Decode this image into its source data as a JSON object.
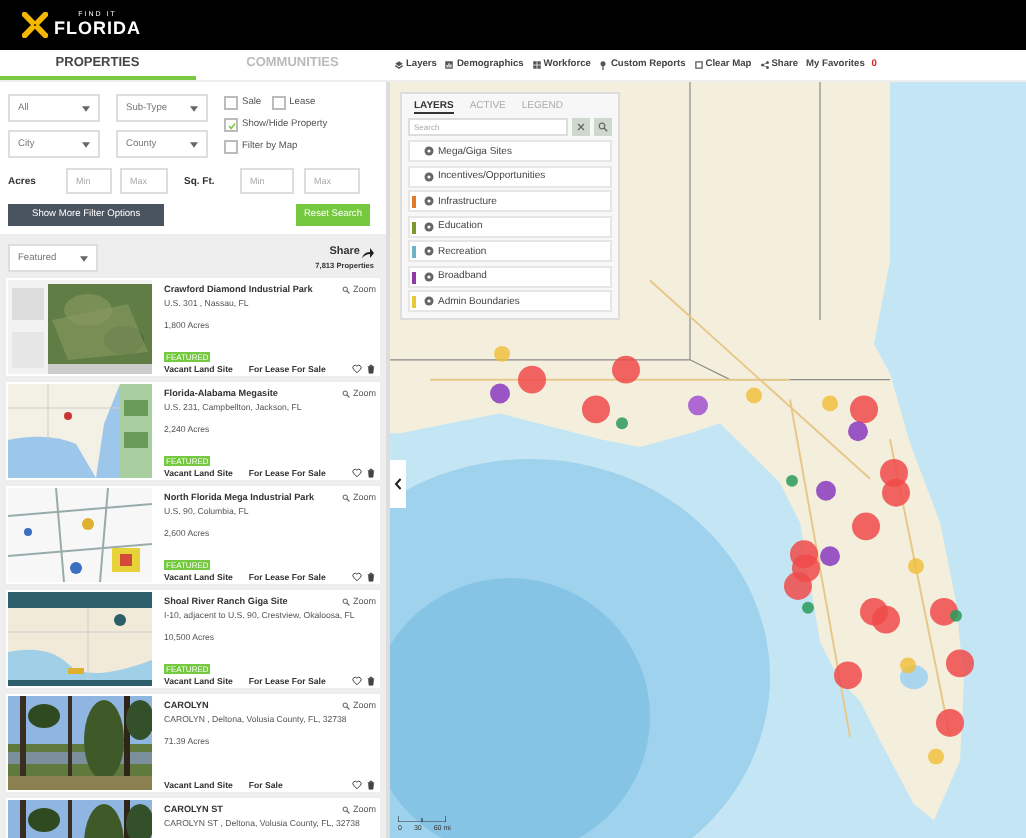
{
  "header": {
    "logo_small": "FIND IT",
    "logo": "FLORIDA"
  },
  "tabs": [
    {
      "label": "PROPERTIES",
      "selected": true
    },
    {
      "label": "COMMUNITIES",
      "selected": false
    }
  ],
  "toolbar": [
    {
      "label": "Layers"
    },
    {
      "label": "Demographics"
    },
    {
      "label": "Workforce"
    },
    {
      "label": "Custom Reports"
    },
    {
      "label": "Clear Map"
    },
    {
      "label": "Share"
    }
  ],
  "favorites": {
    "label": "My Favorites",
    "count": "0"
  },
  "filters": {
    "selects": [
      "All",
      "Sub-Type",
      "City",
      "County"
    ],
    "checkboxes": [
      {
        "label": "Sale",
        "checked": false
      },
      {
        "label": "Lease",
        "checked": false
      },
      {
        "label": "Show/Hide Property",
        "checked": true
      },
      {
        "label": "Filter by Map",
        "checked": false
      }
    ],
    "acres_label": "Acres",
    "acres_min": "Min",
    "acres_max": "Max",
    "sqft_label": "Sq. Ft.",
    "sqft_min": "Min",
    "sqft_max": "Max",
    "more_button": "Show More Filter Options",
    "reset_button": "Reset Search"
  },
  "sort": {
    "value": "Featured",
    "share": "Share",
    "count": "7,813 Properties"
  },
  "listings": [
    {
      "title": "Crawford Diamond Industrial Park",
      "address": "U.S. 301 , Nassau, FL",
      "acres": "1,800 Acres",
      "badge": "FEATURED",
      "type": "Vacant Land Site",
      "status": "For Lease For Sale",
      "zoom": "Zoom"
    },
    {
      "title": "Florida-Alabama Megasite",
      "address": "U.S. 231, Campbellton, Jackson, FL",
      "acres": "2,240 Acres",
      "badge": "FEATURED",
      "type": "Vacant Land Site",
      "status": "For Lease For Sale",
      "zoom": "Zoom"
    },
    {
      "title": "North Florida Mega Industrial Park",
      "address": "U.S. 90, Columbia, FL",
      "acres": "2,600 Acres",
      "badge": "FEATURED",
      "type": "Vacant Land Site",
      "status": "For Lease For Sale",
      "zoom": "Zoom"
    },
    {
      "title": "Shoal River Ranch Giga Site",
      "address": "I-10, adjacent to U.S. 90, Crestview, Okaloosa, FL",
      "acres": "10,500 Acres",
      "badge": "FEATURED",
      "type": "Vacant Land Site",
      "status": "For Lease For Sale",
      "zoom": "Zoom"
    },
    {
      "title": "CAROLYN",
      "address": "CAROLYN , Deltona, Volusia County, FL, 32738",
      "acres": "71.39 Acres",
      "type": "Vacant Land Site",
      "status": "For Sale",
      "zoom": "Zoom"
    },
    {
      "title": "CAROLYN ST",
      "address": "CAROLYN ST , Deltona, Volusia County, FL, 32738",
      "zoom": "Zoom"
    }
  ],
  "layers_panel": {
    "tabs": [
      {
        "label": "LAYERS",
        "selected": true
      },
      {
        "label": "ACTIVE",
        "selected": false
      },
      {
        "label": "LEGEND",
        "selected": false
      }
    ],
    "search_placeholder": "Search",
    "items": [
      {
        "label": "Mega/Giga Sites"
      },
      {
        "label": "Incentives/Opportunities"
      },
      {
        "label": "Infrastructure",
        "color": "#e07b2a"
      },
      {
        "label": "Education",
        "color": "#7a9a2e"
      },
      {
        "label": "Recreation",
        "color": "#6fb3c4"
      },
      {
        "label": "Broadband",
        "color": "#8e3aa8"
      },
      {
        "label": "Admin Boundaries",
        "color": "#e8c93a"
      }
    ]
  },
  "scale": {
    "labels": [
      "0",
      "30",
      "60 mi"
    ]
  }
}
